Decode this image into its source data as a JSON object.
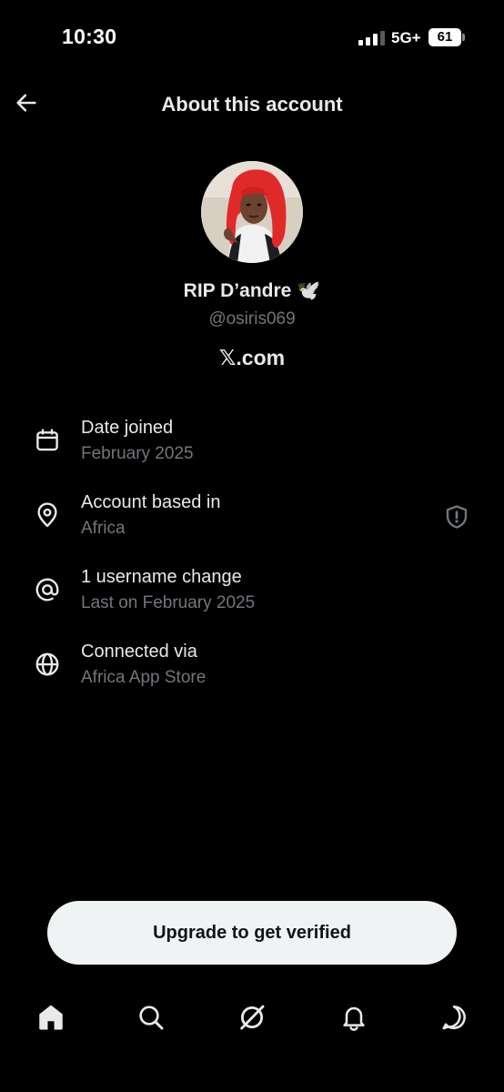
{
  "status_bar": {
    "time": "10:30",
    "network": "5G+",
    "battery": "61"
  },
  "header": {
    "title": "About this account",
    "back_icon": "arrow-left-icon"
  },
  "profile": {
    "display_name": "RIP D’andre 🕊️",
    "handle": "@osiris069",
    "site": "𝕏.com"
  },
  "details": [
    {
      "icon": "calendar-icon",
      "title": "Date joined",
      "subtitle": "February 2025"
    },
    {
      "icon": "location-pin-icon",
      "title": "Account based in",
      "subtitle": "Africa"
    },
    {
      "icon": "at-sign-icon",
      "title": "1 username change",
      "subtitle": "Last on February 2025"
    },
    {
      "icon": "globe-icon",
      "title": "Connected via",
      "subtitle": "Africa App Store"
    }
  ],
  "upgrade_button": {
    "label": "Upgrade to get verified"
  },
  "bottom_nav": {
    "items": [
      "home-icon",
      "search-icon",
      "grok-icon",
      "notifications-icon",
      "messages-icon"
    ]
  },
  "colors": {
    "background": "#000000",
    "primary_text": "#e7e9ea",
    "secondary_text": "#71767b",
    "button_bg": "#eff3f4"
  }
}
